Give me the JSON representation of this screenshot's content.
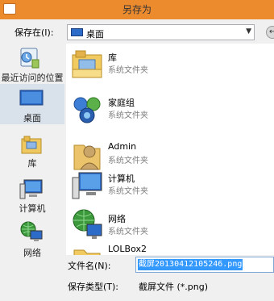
{
  "window": {
    "title": "另存为"
  },
  "location": {
    "label": "保存在(I):",
    "value": "桌面"
  },
  "places": [
    {
      "label": "最近访问的位置",
      "icon": "recent-places-icon"
    },
    {
      "label": "桌面",
      "icon": "desktop-icon"
    },
    {
      "label": "库",
      "icon": "libraries-icon"
    },
    {
      "label": "计算机",
      "icon": "computer-icon"
    },
    {
      "label": "网络",
      "icon": "network-icon"
    }
  ],
  "files": [
    {
      "name": "库",
      "type": "系统文件夹",
      "icon": "libraries-icon"
    },
    {
      "name": "家庭组",
      "type": "系统文件夹",
      "icon": "homegroup-icon"
    },
    {
      "name": "Admin",
      "type": "系统文件夹",
      "icon": "user-folder-icon"
    },
    {
      "name": "计算机",
      "type": "系统文件夹",
      "icon": "computer-icon"
    },
    {
      "name": "网络",
      "type": "系统文件夹",
      "icon": "network-icon"
    },
    {
      "name": "LOLBox2",
      "type": "",
      "icon": "folder-icon"
    }
  ],
  "filename": {
    "label": "文件名(N):",
    "value": "截屏20130412105246.png"
  },
  "filetype": {
    "label": "保存类型(T):",
    "value": "截屏文件 (*.png)"
  },
  "colors": {
    "titlebar": "#ec8a2e",
    "selection": "#3399ff",
    "active_place": "#d9e1ea"
  }
}
